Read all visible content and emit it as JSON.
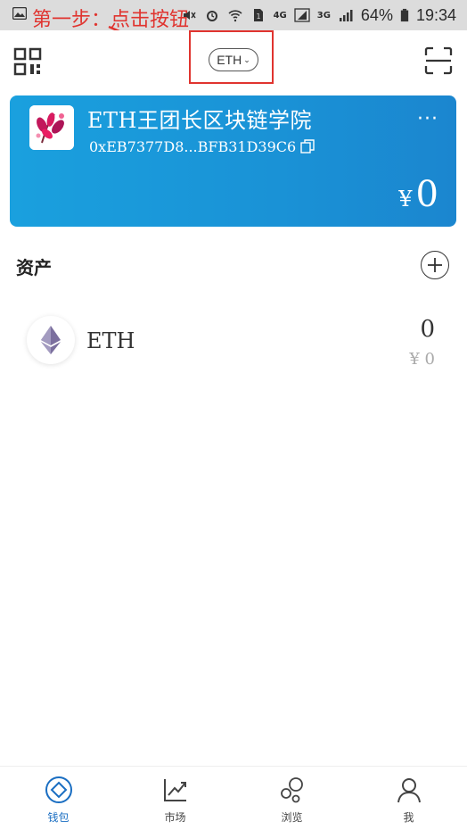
{
  "annotation": {
    "text": "第一步：点击按钮",
    "color": "#e0342f"
  },
  "status_bar": {
    "net_4g": "4G",
    "net_3g": "3G",
    "battery": "64%",
    "time": "19:34"
  },
  "header": {
    "network_button": "ETH",
    "left_icon": "qr-code-icon",
    "right_icon": "scan-icon"
  },
  "wallet": {
    "name": "ETH王团长区块链学院",
    "address": "0xEB7377D8...BFB31D39C6",
    "currency_symbol": "¥",
    "balance": "0",
    "accent_color": "#1a9bdc"
  },
  "assets": {
    "title": "资产",
    "items": [
      {
        "name": "ETH",
        "amount": "0",
        "fiat": "¥ 0",
        "icon": "ethereum-icon"
      }
    ]
  },
  "tabbar": {
    "tabs": [
      {
        "label": "钱包",
        "icon": "wallet-icon",
        "active": true
      },
      {
        "label": "市场",
        "icon": "market-chart-icon",
        "active": false
      },
      {
        "label": "浏览",
        "icon": "browse-bubbles-icon",
        "active": false
      },
      {
        "label": "我",
        "icon": "user-icon",
        "active": false
      }
    ],
    "active_color": "#1a6ec2"
  }
}
